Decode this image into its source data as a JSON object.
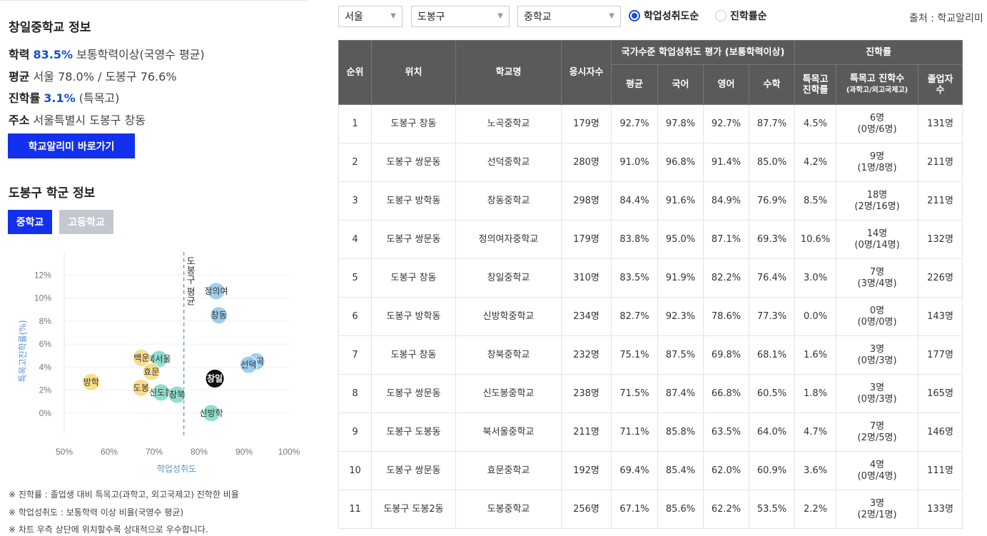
{
  "school": {
    "title": "창일중학교 정보",
    "achievement_label": "학력",
    "achievement_value": "83.5%",
    "achievement_desc": "보통학력이상(국영수 평균)",
    "average_label": "평균",
    "average_value": "서울 78.0% / 도봉구 76.6%",
    "advance_label": "진학률",
    "advance_value": "3.1%",
    "advance_desc": "(특목고)",
    "address_label": "주소",
    "address_value": "서울특별시 도봉구 창동",
    "link_button": "학교알리미 바로가기"
  },
  "district": {
    "title": "도봉구 학군 정보",
    "tabs": [
      "중학교",
      "고등학교"
    ],
    "selected_tab": "중학교"
  },
  "chart_data": {
    "type": "scatter",
    "xlabel": "학업성취도",
    "ylabel": "특목고진학률(%)",
    "xlim": [
      50,
      100
    ],
    "ylim": [
      -1,
      14
    ],
    "xticks": [
      "50%",
      "60%",
      "70%",
      "80%",
      "90%",
      "100%"
    ],
    "yticks": [
      "0%",
      "2%",
      "4%",
      "6%",
      "8%",
      "10%",
      "12%"
    ],
    "ref_line": {
      "x": 76.6,
      "label": "도봉구 평균"
    },
    "colors": {
      "yellow": "#f7d777",
      "teal": "#7dd8c4",
      "blue": "#8ec6ea",
      "black": "#111111"
    },
    "points": [
      {
        "label": "정의여",
        "x": 83.8,
        "y": 10.6,
        "color": "blue"
      },
      {
        "label": "창동",
        "x": 84.4,
        "y": 8.5,
        "color": "blue"
      },
      {
        "label": "노곡",
        "x": 92.7,
        "y": 4.5,
        "color": "blue"
      },
      {
        "label": "선덕",
        "x": 91.0,
        "y": 4.2,
        "color": "blue"
      },
      {
        "label": "창일",
        "x": 83.5,
        "y": 3.0,
        "color": "black"
      },
      {
        "label": "신방학",
        "x": 82.7,
        "y": 0.0,
        "color": "teal"
      },
      {
        "label": "북서울",
        "x": 71.1,
        "y": 4.7,
        "color": "teal"
      },
      {
        "label": "신도봉",
        "x": 71.5,
        "y": 1.8,
        "color": "teal"
      },
      {
        "label": "창북",
        "x": 75.1,
        "y": 1.6,
        "color": "teal"
      },
      {
        "label": "백운",
        "x": 67.2,
        "y": 4.8,
        "color": "yellow"
      },
      {
        "label": "효문",
        "x": 69.4,
        "y": 3.6,
        "color": "yellow"
      },
      {
        "label": "방학",
        "x": 56.0,
        "y": 2.7,
        "color": "yellow"
      },
      {
        "label": "도봉",
        "x": 67.1,
        "y": 2.2,
        "color": "yellow"
      }
    ]
  },
  "notes": [
    "※ 진학률 : 졸업생 대비 특목고(과학고, 외고국제고) 진학한 비율",
    "※ 학업성취도 : 보통학력 이상 비율(국영수 평균)",
    "※ 차트 우측 상단에 위치할수록 상대적으로 우수합니다."
  ],
  "filters": {
    "region": "서울",
    "district": "도봉구",
    "level": "중학교",
    "sort_options": [
      "학업성취도순",
      "진학률순"
    ],
    "selected_sort": "학업성취도순",
    "source": "출처 : 학교알리미"
  },
  "table": {
    "headers": {
      "rank": "순위",
      "location": "위치",
      "school": "학교명",
      "examinees": "응시자수",
      "national_group": "국가수준 학업성취도 평가 (보통학력이상)",
      "advance_group": "진학률",
      "avg": "평균",
      "kor": "국어",
      "eng": "영어",
      "math": "수학",
      "special_rate_1": "특목고",
      "special_rate_2": "진학률",
      "special_count_1": "특목고 진학수",
      "special_count_2": "(과학고/외고국제고)",
      "grads_1": "졸업자",
      "grads_2": "수"
    },
    "rows": [
      {
        "rank": "1",
        "loc": "도봉구 창동",
        "name": "노곡중학교",
        "n": "179명",
        "avg": "92.7%",
        "kor": "97.8%",
        "eng": "92.7%",
        "math": "87.7%",
        "rate": "4.5%",
        "cnt": "6명",
        "cnt_detail": "(0명/6명)",
        "grad": "131명"
      },
      {
        "rank": "2",
        "loc": "도봉구 쌍문동",
        "name": "선덕중학교",
        "n": "280명",
        "avg": "91.0%",
        "kor": "96.8%",
        "eng": "91.4%",
        "math": "85.0%",
        "rate": "4.2%",
        "cnt": "9명",
        "cnt_detail": "(1명/8명)",
        "grad": "211명"
      },
      {
        "rank": "3",
        "loc": "도봉구 방학동",
        "name": "창동중학교",
        "n": "298명",
        "avg": "84.4%",
        "kor": "91.6%",
        "eng": "84.9%",
        "math": "76.9%",
        "rate": "8.5%",
        "cnt": "18명",
        "cnt_detail": "(2명/16명)",
        "grad": "211명"
      },
      {
        "rank": "4",
        "loc": "도봉구 쌍문동",
        "name": "정의여자중학교",
        "n": "179명",
        "avg": "83.8%",
        "kor": "95.0%",
        "eng": "87.1%",
        "math": "69.3%",
        "rate": "10.6%",
        "cnt": "14명",
        "cnt_detail": "(0명/14명)",
        "grad": "132명"
      },
      {
        "rank": "5",
        "loc": "도봉구 창동",
        "name": "창일중학교",
        "n": "310명",
        "avg": "83.5%",
        "kor": "91.9%",
        "eng": "82.2%",
        "math": "76.4%",
        "rate": "3.0%",
        "cnt": "7명",
        "cnt_detail": "(3명/4명)",
        "grad": "226명"
      },
      {
        "rank": "6",
        "loc": "도봉구 방학동",
        "name": "신방학중학교",
        "n": "234명",
        "avg": "82.7%",
        "kor": "92.3%",
        "eng": "78.6%",
        "math": "77.3%",
        "rate": "0.0%",
        "cnt": "0명",
        "cnt_detail": "(0명/0명)",
        "grad": "143명"
      },
      {
        "rank": "7",
        "loc": "도봉구 창동",
        "name": "창북중학교",
        "n": "232명",
        "avg": "75.1%",
        "kor": "87.5%",
        "eng": "69.8%",
        "math": "68.1%",
        "rate": "1.6%",
        "cnt": "3명",
        "cnt_detail": "(0명/3명)",
        "grad": "177명"
      },
      {
        "rank": "8",
        "loc": "도봉구 쌍문동",
        "name": "신도봉중학교",
        "n": "238명",
        "avg": "71.5%",
        "kor": "87.4%",
        "eng": "66.8%",
        "math": "60.5%",
        "rate": "1.8%",
        "cnt": "3명",
        "cnt_detail": "(0명/3명)",
        "grad": "165명"
      },
      {
        "rank": "9",
        "loc": "도봉구 도봉동",
        "name": "북서울중학교",
        "n": "211명",
        "avg": "71.1%",
        "kor": "85.8%",
        "eng": "63.5%",
        "math": "64.0%",
        "rate": "4.7%",
        "cnt": "7명",
        "cnt_detail": "(2명/5명)",
        "grad": "146명"
      },
      {
        "rank": "10",
        "loc": "도봉구 쌍문동",
        "name": "효문중학교",
        "n": "192명",
        "avg": "69.4%",
        "kor": "85.4%",
        "eng": "62.0%",
        "math": "60.9%",
        "rate": "3.6%",
        "cnt": "4명",
        "cnt_detail": "(0명/4명)",
        "grad": "111명"
      },
      {
        "rank": "11",
        "loc": "도봉구 도봉2동",
        "name": "도봉중학교",
        "n": "256명",
        "avg": "67.1%",
        "kor": "85.6%",
        "eng": "62.2%",
        "math": "53.5%",
        "rate": "2.2%",
        "cnt": "3명",
        "cnt_detail": "(2명/1명)",
        "grad": "133명"
      }
    ]
  }
}
